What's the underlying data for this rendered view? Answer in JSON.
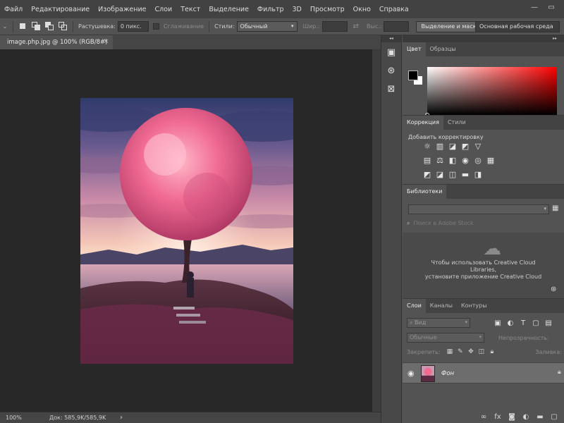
{
  "menu": [
    "Файл",
    "Редактирование",
    "Изображение",
    "Слои",
    "Текст",
    "Выделение",
    "Фильтр",
    "3D",
    "Просмотр",
    "Окно",
    "Справка"
  ],
  "window_controls": {
    "minimize": "—",
    "restore": "▭"
  },
  "options_bar": {
    "feather_label": "Растушевка:",
    "feather_value": "0 пикс.",
    "antialias_label": "Сглаживание",
    "style_label": "Стили:",
    "style_value": "Обычный",
    "width_label": "Шир.:",
    "height_label": "Выс.:",
    "select_mask_button": "Выделение и маска...",
    "workspace": "Основная рабочая среда"
  },
  "document": {
    "tab_title": "image.php.jpg @ 100% (RGB/8#)",
    "close": "×",
    "zoom": "100%",
    "doc_size": "Док: 585,9K/585,9K",
    "status_arrow": "›"
  },
  "strip": {
    "collapse": "◂◂"
  },
  "panels": {
    "collapse": "▸▸",
    "color_tabs": [
      "Цвет",
      "Образцы"
    ],
    "adjust_tabs": [
      "Коррекция",
      "Стили"
    ],
    "adjust_title": "Добавить корректировку",
    "adjust_row1": [
      "☼",
      "▥",
      "◪",
      "◩",
      "▽"
    ],
    "adjust_row2": [
      "▤",
      "⚖",
      "◧",
      "◉",
      "◎",
      "▦"
    ],
    "adjust_row3": [
      "◩",
      "◪",
      "◫",
      "▬",
      "◨"
    ],
    "libraries_tab": "Библиотеки",
    "libraries_search_placeholder": "Поиск в Adobe Stock",
    "libraries_message": [
      "Чтобы использовать Creative Cloud",
      "Libraries,",
      "установите приложение Creative Cloud"
    ],
    "layers_tabs": [
      "Слои",
      "Каналы",
      "Контуры"
    ],
    "layers_filter": "Вид",
    "layers_blend": "Обычные",
    "opacity_label": "Непрозрачность:",
    "lock_label": "Закрепить:",
    "fill_label": "Заливка:",
    "layer_name": "Фон"
  }
}
